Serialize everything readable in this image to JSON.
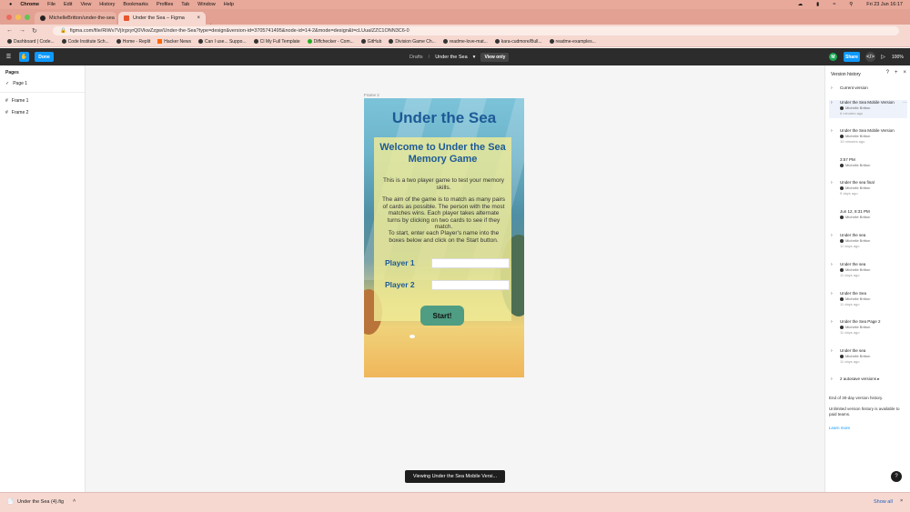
{
  "menubar": {
    "items": [
      "Chrome",
      "File",
      "Edit",
      "View",
      "History",
      "Bookmarks",
      "Profiles",
      "Tab",
      "Window",
      "Help"
    ],
    "clock": "Fri 23 Jun  16:17"
  },
  "tabs": [
    {
      "title": "MichelleBritton/under-the-sea"
    },
    {
      "title": "Under the Sea – Figma"
    }
  ],
  "toolbar": {
    "url": "figma.com/file/RiWv7VjIrgxyrQ0VkwZzgw/Under-the-Sea?type=design&version-id=3705741495&node-id=14-2&mode=design&t=cLUuaIZZC1ONN3C6-0"
  },
  "bookmarks": [
    "Dashboard | Code...",
    "Code Institute Sch...",
    "Home - Replit",
    "Hacker News",
    "Can I use... Suppo...",
    "CI My Full Template",
    "Diffchecker - Com...",
    "GitHub",
    "Division Game Ch...",
    "readme-love-mat...",
    "kara-cudmore/Bull...",
    "readme-examples..."
  ],
  "figma_top": {
    "done_label": "Done",
    "breadcrumb_drafts": "Drafts",
    "breadcrumb_sep": "/",
    "file_name": "Under the Sea",
    "view_only": "View only",
    "share_label": "Share",
    "avatar_initial": "M",
    "zoom": "100%"
  },
  "left_panel": {
    "pages_heading": "Pages",
    "current_page": "Page 1",
    "layers": [
      "Frame 1",
      "Frame 2"
    ]
  },
  "canvas": {
    "frame_label": "Frame 2",
    "frame_title": "Under the Sea",
    "welcome": "Welcome to Under the Sea Memory Game",
    "para1": "This is a two player game to test your memory skills.",
    "para2": "The aim of the game is to match as many pairs of cards as possible. The person with the most matches wins. Each player takes alternate turns by clicking on two cards to see if they match.",
    "para3": "To start, enter each Player's name into the boxes below and click on the Start button.",
    "player1": "Player 1",
    "player2": "Player 2",
    "start": "Start!",
    "toast": "Viewing Under the Sea Mobile Versi..."
  },
  "version_history": {
    "title": "Version history",
    "current": "Current version",
    "versions": [
      {
        "title": "Under the Sea Mobile Version",
        "user": "Michelle Britton",
        "date": "6 minutes ago"
      },
      {
        "title": "Under the Sea Mobile Version",
        "user": "Michelle Britton",
        "date": "10 minutes ago"
      },
      {
        "title": "3:57 PM",
        "user": "Michelle Britton",
        "date": ""
      },
      {
        "title": "Under the sea final",
        "user": "Michelle Britton",
        "date": "5 days ago"
      },
      {
        "title": "Jun 12, 8:31 PM",
        "user": "Michelle Britton",
        "date": ""
      },
      {
        "title": "Under the sea",
        "user": "Michelle Britton",
        "date": "11 days ago"
      },
      {
        "title": "Under the sea",
        "user": "Michelle Britton",
        "date": "11 days ago"
      },
      {
        "title": "Under the Sea",
        "user": "Michelle Britton",
        "date": "11 days ago"
      },
      {
        "title": "Under the Sea Page 2",
        "user": "Michelle Britton",
        "date": "11 days ago"
      },
      {
        "title": "Under the sea",
        "user": "Michelle Britton",
        "date": "11 days ago"
      }
    ],
    "autosave": "2 autosave versions",
    "end_note": "End of 30-day version history.",
    "paid_note": "Unlimited version history is available to paid teams.",
    "learn_more": "Learn more"
  },
  "downloads": {
    "file": "Under the Sea (4).fig",
    "show_all": "Show all"
  }
}
